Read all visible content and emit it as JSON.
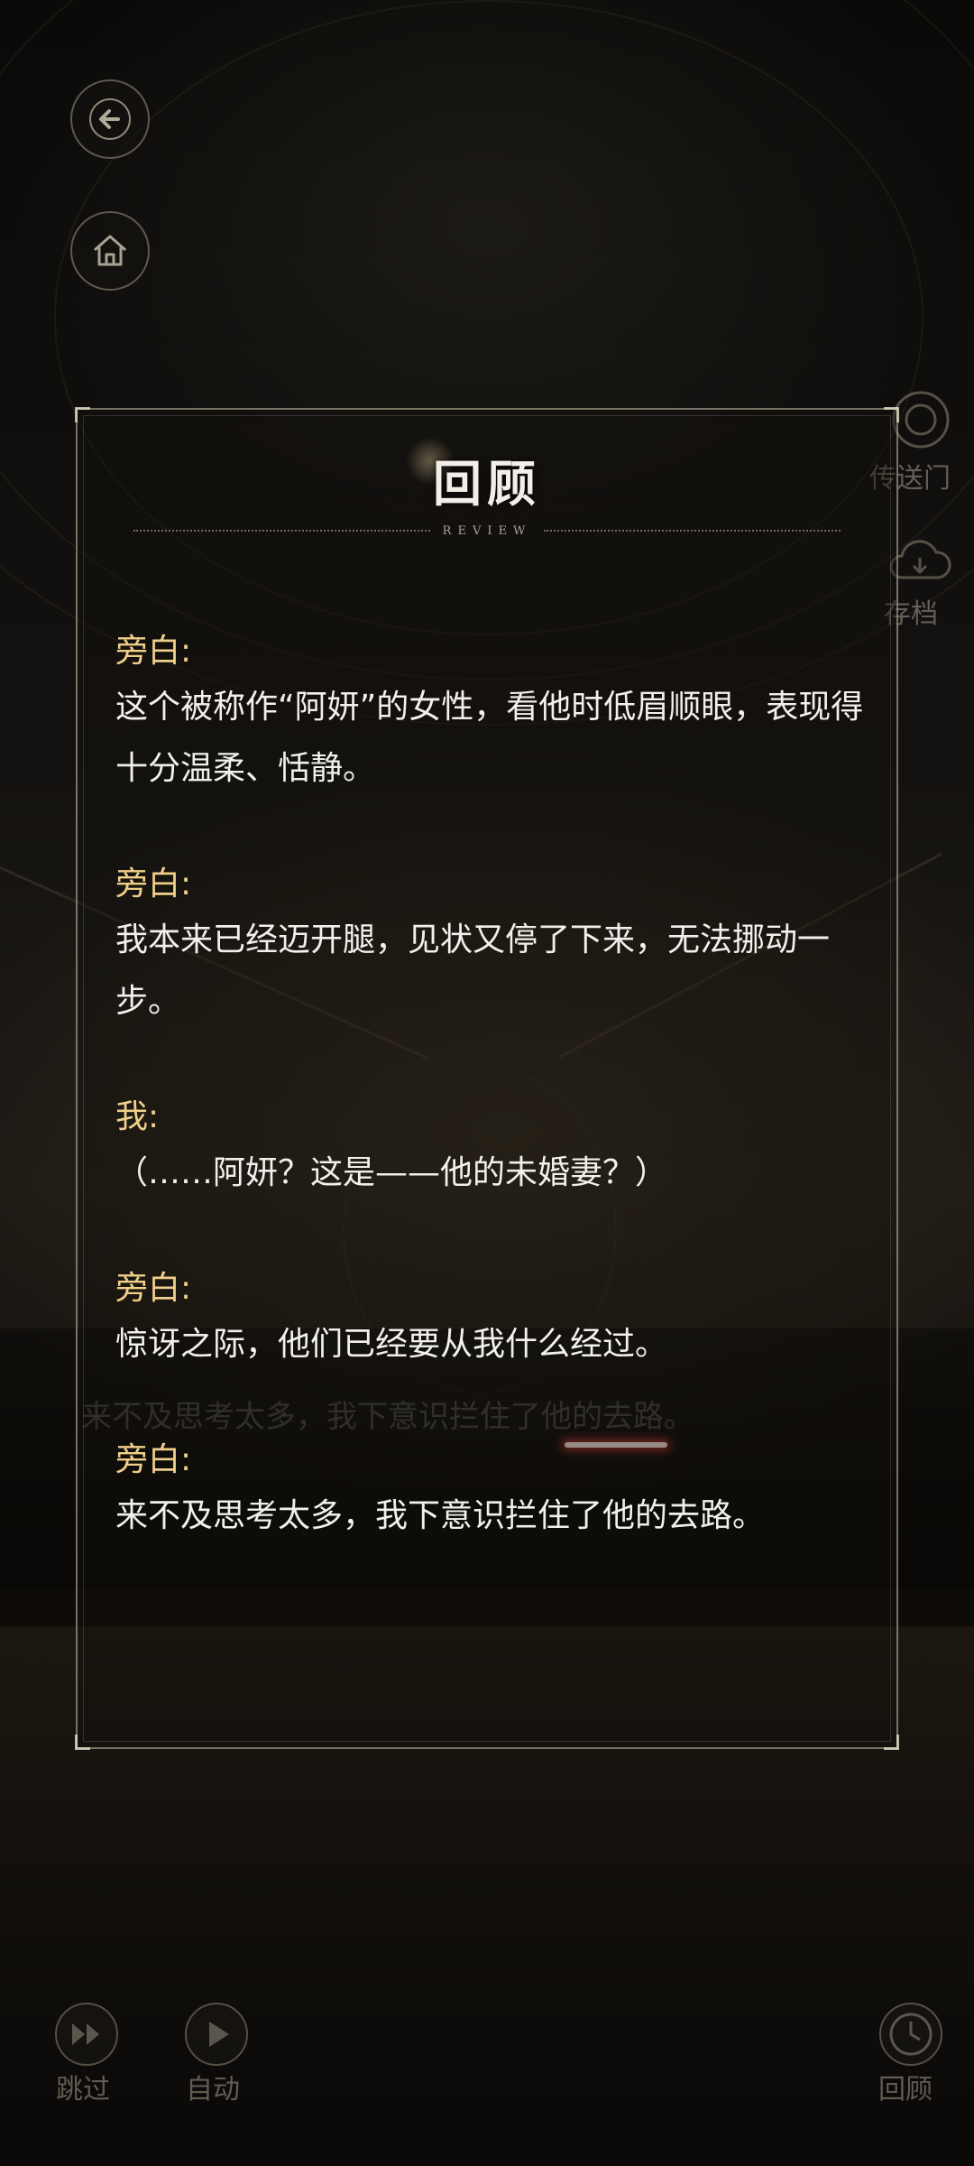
{
  "review": {
    "title": "回顾",
    "subtitle": "REVIEW",
    "entries": [
      {
        "speaker": "旁白:",
        "text": "这个被称作“阿妍”的女性，看他时低眉顺眼，表现得十分温柔、恬静。"
      },
      {
        "speaker": "旁白:",
        "text": "我本来已经迈开腿，见状又停了下来，无法挪动一步。"
      },
      {
        "speaker": "我:",
        "text": "（……阿妍？这是——他的未婚妻？）"
      },
      {
        "speaker": "旁白:",
        "text": "惊讶之际，他们已经要从我什么经过。"
      },
      {
        "speaker": "旁白:",
        "text": "来不及思考太多，我下意识拦住了他的去路。"
      }
    ]
  },
  "background_ui": {
    "side_menu": {
      "portal_label": "传送门",
      "save_label": "存档"
    },
    "bottom_bar": {
      "skip_label": "跳过",
      "auto_label": "自动",
      "review_label": "回顾"
    },
    "dialogue_line": "来不及思考太多，我下意识拦住了他的去路。"
  },
  "colors": {
    "speaker": "#f0cf8a",
    "text": "#f2f0ec",
    "panel_border": "#cdc3af"
  },
  "icons": [
    "back-arrow-icon",
    "home-icon",
    "portal-icon",
    "cloud-save-icon",
    "fast-forward-icon",
    "play-icon",
    "clock-icon"
  ]
}
